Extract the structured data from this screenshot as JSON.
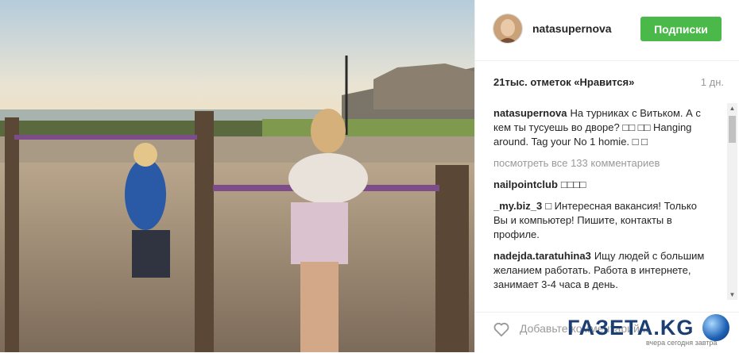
{
  "post": {
    "username": "natasupernova",
    "follow_label": "Подписки",
    "likes": "21тыс. отметок «Нравится»",
    "time": "1 дн.",
    "view_all": "посмотреть все 133 комментариев",
    "comment_placeholder": "Добавьте комментарий..."
  },
  "comments": [
    {
      "user": "natasupernova",
      "text": "На турниках с Витьком. А с кем ты тусуешь во дворе? □□ □□ Hanging around. Tag your No 1 homie. □ □"
    },
    {
      "user": "nailpointclub",
      "text": "□□□□"
    },
    {
      "user": "_my.biz_3",
      "text": "□ Интересная вакансия! Только Вы и компьютер! Пишите, контакты в профиле."
    },
    {
      "user": "nadejda.taratuhina3",
      "text": "Ищу людей с большим желанием работать. Работа в интернете, занимает 3-4 часа в день."
    }
  ],
  "watermark": {
    "brand": "ГАЗЕТА.KG",
    "tagline": "вчера сегодня завтра"
  },
  "colors": {
    "follow_button": "#4ab949",
    "accent_brand": "#1c3f73"
  },
  "icons": {
    "like": "heart-icon",
    "scroll_up": "triangle-up-icon",
    "scroll_down": "triangle-down-icon"
  }
}
